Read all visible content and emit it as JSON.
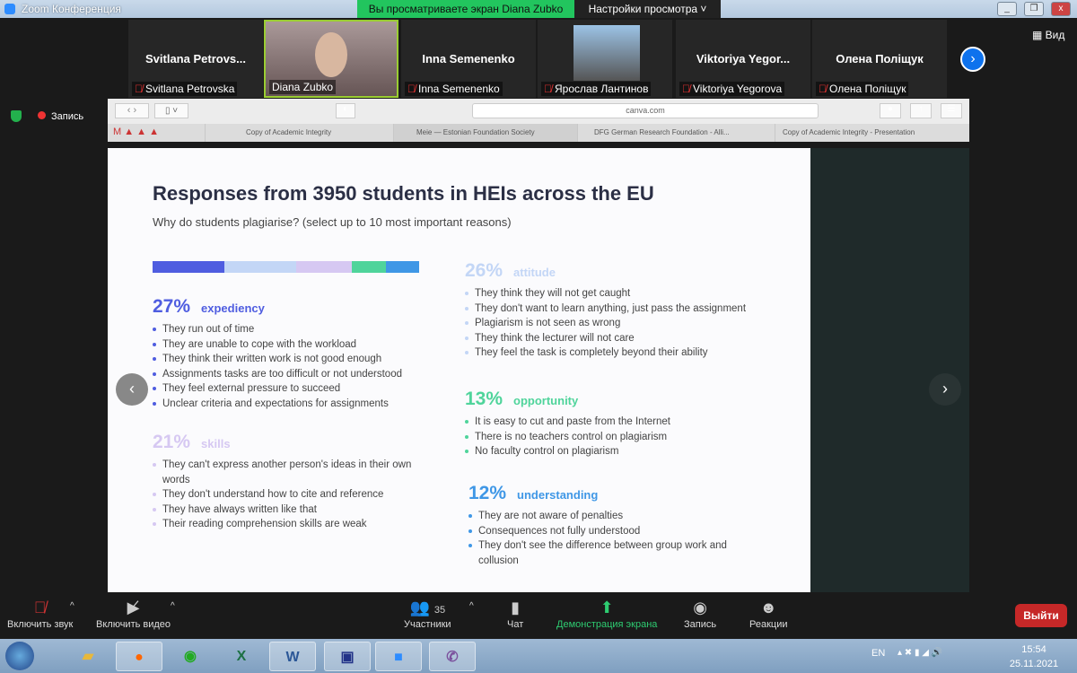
{
  "window": {
    "title": "Zoom Конференция",
    "share_banner": "Вы просматриваете экран Diana Zubko",
    "view_settings": "Настройки просмотра",
    "view_button": "Вид",
    "recording_label": "Запись"
  },
  "participants": [
    {
      "tile_name": "Svitlana  Petrovs...",
      "label": "Svitlana Petrovska",
      "muted": true,
      "video": false
    },
    {
      "tile_name": "",
      "label": "Diana Zubko",
      "muted": false,
      "video": true
    },
    {
      "tile_name": "Inna Semenenko",
      "label": "Inna Semenenko",
      "muted": true,
      "video": false
    },
    {
      "tile_name": "",
      "label": "Ярослав Лантинов",
      "muted": true,
      "video": true
    },
    {
      "tile_name": "Viktoriya  Yegor...",
      "label": "Viktoriya Yegorova",
      "muted": true,
      "video": false
    },
    {
      "tile_name": "Олена Поліщук",
      "label": "Олена Поліщук",
      "muted": true,
      "video": false
    }
  ],
  "browser": {
    "url": "canva.com",
    "tabs": [
      "Copy of Academic Integrity",
      "Meie — Estonian Foundation Society",
      "DFG German Research Foundation - Alli...",
      "Copy of Academic Integrity - Presentation"
    ]
  },
  "slide": {
    "title": "Responses from 3950 students in HEIs across the EU",
    "subtitle": "Why do students plagiarise? (select up to 10 most important reasons)",
    "bar_colors": [
      "#4f5de0",
      "#c3d6f6",
      "#d6c8f2",
      "#4fd49b",
      "#3f97e6"
    ],
    "groups": [
      {
        "pct": "27%",
        "category": "expediency",
        "color": "#4f5de0",
        "items": [
          "They run out of time",
          "They are unable to cope with the workload",
          "They think their written work is not good enough",
          "Assignments tasks are too difficult or not understood",
          "They feel external pressure to succeed",
          "Unclear criteria and expectations for assignments"
        ]
      },
      {
        "pct": "21%",
        "category": "skills",
        "color": "#d6c8f2",
        "items": [
          "They can't express another person's ideas in their own words",
          "They don't understand how to cite and reference",
          "They have always written like that",
          "Their reading comprehension skills are weak"
        ]
      },
      {
        "pct": "26%",
        "category": "attitude",
        "color": "#c3d6f6",
        "items": [
          "They think they will not get caught",
          "They don't want to learn anything, just pass the assignment",
          "Plagiarism is not seen as wrong",
          "They think the lecturer will not care",
          "They feel the task is completely beyond their ability"
        ]
      },
      {
        "pct": "13%",
        "category": "opportunity",
        "color": "#4fd49b",
        "items": [
          "It is easy to cut and paste from the Internet",
          "There is no teachers control on plagiarism",
          "No faculty control on plagiarism"
        ]
      },
      {
        "pct": "12%",
        "category": "understanding",
        "color": "#3f97e6",
        "items": [
          "They are not aware of penalties",
          "Consequences not fully understood",
          "They don't see the difference between group work and collusion"
        ]
      }
    ]
  },
  "toolbar": {
    "unmute": "Включить звук",
    "start_video": "Включить видео",
    "participants": "Участники",
    "participants_count": "35",
    "chat": "Чат",
    "share_screen": "Демонстрация экрана",
    "record": "Запись",
    "reactions": "Реакции",
    "leave": "Выйти"
  },
  "taskbar": {
    "lang": "EN",
    "time": "15:54",
    "date": "25.11.2021"
  }
}
